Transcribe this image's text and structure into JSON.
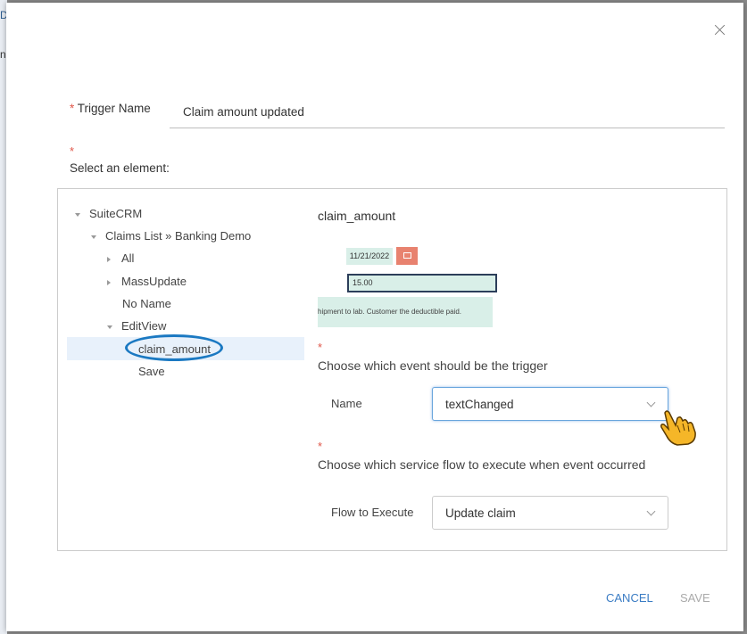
{
  "dialog": {
    "trigger_name_label": "Trigger Name",
    "trigger_name_value": "Claim amount updated",
    "required_mark": "*",
    "select_element_label": "Select an element:"
  },
  "tree": {
    "root": "SuiteCRM",
    "claims": "Claims List » Banking Demo",
    "all": "All",
    "massupdate": "MassUpdate",
    "noname": "No Name",
    "editview": "EditView",
    "claim_amount": "claim_amount",
    "save": "Save"
  },
  "element": {
    "title": "claim_amount",
    "preview_date": "11/21/2022",
    "preview_amount": "15.00",
    "preview_notes": "hipment to lab. Customer the deductible paid."
  },
  "event": {
    "heading": "Choose which event should be the trigger",
    "name_label": "Name",
    "name_value": "textChanged"
  },
  "flow": {
    "heading": "Choose which service flow to execute when event occurred",
    "label": "Flow to Execute",
    "value": "Update claim"
  },
  "buttons": {
    "cancel": "CANCEL",
    "save": "SAVE"
  },
  "colors": {
    "accent": "#3a7cc4",
    "required": "#e0574a",
    "highlight_oval": "#1b79c2",
    "preview_bg": "#d9efe8"
  },
  "backdrop": {
    "glyph_d": "D",
    "glyph_n": "n"
  }
}
